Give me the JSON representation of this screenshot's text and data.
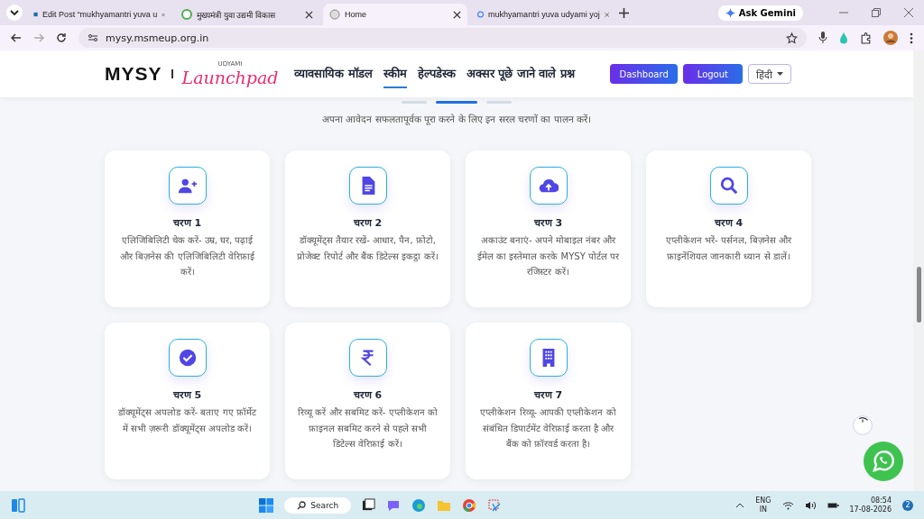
{
  "browser": {
    "tabs": [
      {
        "title": "Edit Post “mukhyamantri yuva u",
        "selected": false
      },
      {
        "title": "मुख्यमंत्री युवा उद्यमी विकास",
        "selected": false
      },
      {
        "title": "Home",
        "selected": true
      },
      {
        "title": "mukhyamantri yuva udyami yoj",
        "selected": false
      }
    ],
    "ask_gemini": "Ask Gemini",
    "address": "mysy.msmeup.org.in"
  },
  "site": {
    "logo": "MYSY",
    "logo_small": "UDYAMI",
    "logo_script": "Launchpad",
    "nav": [
      {
        "label": "व्यावसायिक मॉडल",
        "selected": false
      },
      {
        "label": "स्कीम",
        "selected": true
      },
      {
        "label": "हेल्पडेस्क",
        "selected": false
      },
      {
        "label": "अक्सर पूछे जाने वाले प्रश्न",
        "selected": false
      }
    ],
    "dashboard": "Dashboard",
    "logout": "Logout",
    "language": "हिंदी"
  },
  "carousel_dots": [
    {
      "selected": false
    },
    {
      "selected": true
    },
    {
      "selected": false
    }
  ],
  "subtitle": "अपना आवेदन सफलतापूर्वक पूरा करने के लिए इन सरल चरणों का पालन करें।",
  "steps": [
    {
      "title": "चरण 1",
      "text": "एलिजिबिलिटी चेक करें- उम्र, घर, पढ़ाई और बिज़नेस की एलिजिबिलिटी वेरिफ़ाई करें।"
    },
    {
      "title": "चरण 2",
      "text": "डॉक्यूमेंट्स तैयार रखें- आधार, पैन, फ़ोटो, प्रोजेक्ट रिपोर्ट और बैंक डिटेल्स इकट्ठा करें।"
    },
    {
      "title": "चरण 3",
      "text": "अकाउंट बनाएं- अपने मोबाइल नंबर और ईमेल का इस्तेमाल करके MYSY पोर्टल पर रजिस्टर करें।"
    },
    {
      "title": "चरण 4",
      "text": "एप्लीकेशन भरें- पर्सनल, बिज़नेस और फ़ाइनेंशियल जानकारी ध्यान से डालें।"
    },
    {
      "title": "चरण 5",
      "text": "डॉक्यूमेंट्स अपलोड करें- बताए गए फ़ॉर्मेट में सभी ज़रूरी डॉक्यूमेंट्स अपलोड करें।"
    },
    {
      "title": "चरण 6",
      "text": "रिव्यू करें और सबमिट करें- एप्लीकेशन को फ़ाइनल सबमिट करने से पहले सभी डिटेल्स वेरिफ़ाई करें।"
    },
    {
      "title": "चरण 7",
      "text": "एप्लीकेशन रिव्यू- आपकी एप्लीकेशन को संबंधित डिपार्टमेंट वेरिफ़ाई करता है और बैंक को फ़ॉरवर्ड करता है।"
    }
  ],
  "taskbar": {
    "search": "Search",
    "lang": "ENG",
    "region": "IN",
    "time": "08:54",
    "date": "17-08-2026",
    "notifications": "2"
  }
}
